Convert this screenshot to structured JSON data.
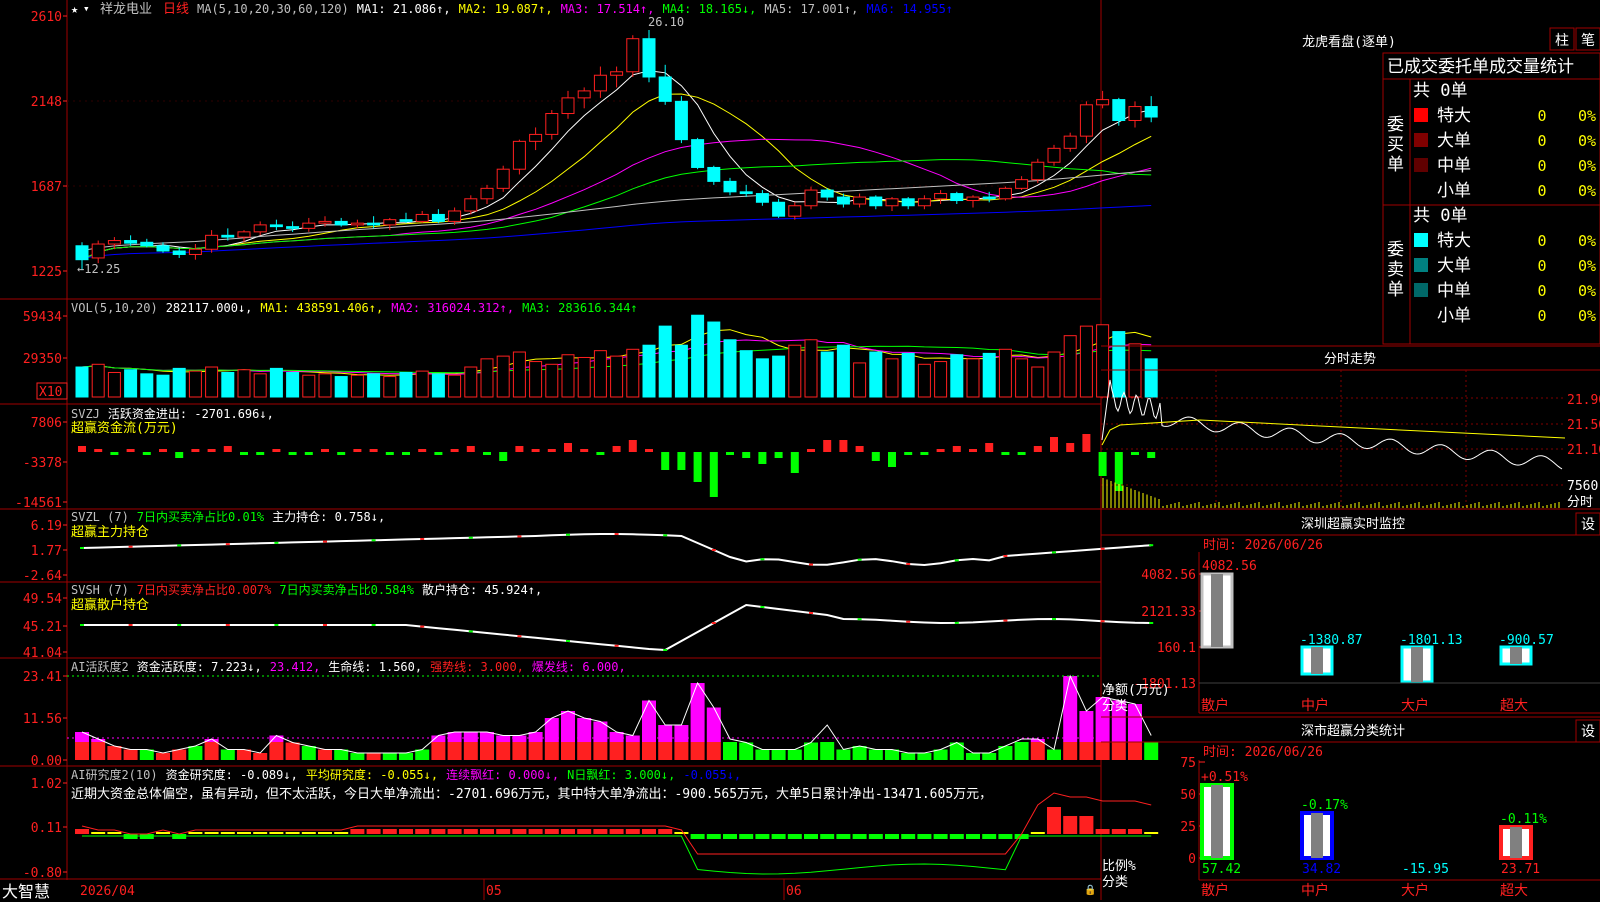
{
  "stock": {
    "name": "祥龙电业",
    "period": "日线"
  },
  "brand": "大智慧",
  "colors": {
    "up": "#ff2020",
    "down": "#00ffff",
    "green": "#00ff00",
    "yellow": "#ffff00",
    "magenta": "#ff00ff",
    "white": "#ffffff",
    "grid": "#a00000",
    "blue": "#0000ff",
    "orange": "#ff9900"
  },
  "kline_panel": {
    "header": [
      {
        "t": "MA(5,10,20,30,60,120)",
        "c": "#c0c0c0"
      },
      {
        "t": "MA1: 21.086↑,",
        "c": "#ffffff"
      },
      {
        "t": "MA2: 19.087↑,",
        "c": "#ffff00"
      },
      {
        "t": "MA3: 17.514↑,",
        "c": "#ff00ff"
      },
      {
        "t": "MA4: 18.165↓,",
        "c": "#00ff00"
      },
      {
        "t": "MA5: 17.001↑,",
        "c": "#c0c0c0"
      },
      {
        "t": "MA6: 14.955↑",
        "c": "#0000ff"
      }
    ],
    "y_labels": [
      "2610",
      "2148",
      "1687",
      "1225"
    ],
    "high_label": "26.10",
    "low_label": "←12.25"
  },
  "vol_panel": {
    "header": [
      {
        "t": "VOL(5,10,20)",
        "c": "#c0c0c0"
      },
      {
        "t": "282117.000↓,",
        "c": "#ffffff"
      },
      {
        "t": "MA1: 438591.406↑,",
        "c": "#ffff00"
      },
      {
        "t": "MA2: 316024.312↑,",
        "c": "#ff00ff"
      },
      {
        "t": "MA3: 283616.344↑",
        "c": "#00ff00"
      }
    ],
    "y_labels": [
      "59434",
      "29350"
    ],
    "unit": "X10"
  },
  "svzj_panel": {
    "header": [
      {
        "t": "SVZJ",
        "c": "#c0c0c0"
      },
      {
        "t": "活跃资金进出: -2701.696↓,",
        "c": "#ffffff"
      }
    ],
    "subtitle": "超赢资金流(万元)",
    "y_labels": [
      "7806",
      "-3378",
      "-14561"
    ]
  },
  "svzl_panel": {
    "header": [
      {
        "t": "SVZL (7)",
        "c": "#c0c0c0"
      },
      {
        "t": "7日内买卖净占比0.01%",
        "c": "#00ff00"
      },
      {
        "t": "主力持仓: 0.758↓,",
        "c": "#ffffff"
      }
    ],
    "subtitle": "超赢主力持仓",
    "y_labels": [
      "6.19",
      "1.77",
      "-2.64"
    ]
  },
  "svsh_panel": {
    "header": [
      {
        "t": "SVSH (7)",
        "c": "#c0c0c0"
      },
      {
        "t": "7日内买卖净占比0.007%",
        "c": "#ff2020"
      },
      {
        "t": "7日内买卖净占比0.584%",
        "c": "#00ff00"
      },
      {
        "t": "散户持仓: 45.924↑,",
        "c": "#ffffff"
      }
    ],
    "subtitle": "超赢散户持仓",
    "y_labels": [
      "49.54",
      "45.21",
      "41.04"
    ]
  },
  "ai1_panel": {
    "header": [
      {
        "t": "AI活跃度2",
        "c": "#c0c0c0"
      },
      {
        "t": "资金活跃度: 7.223↓,",
        "c": "#ffffff"
      },
      {
        "t": "23.412,",
        "c": "#ff00ff"
      },
      {
        "t": "生命线: 1.560,",
        "c": "#ffffff"
      },
      {
        "t": "强势线: 3.000,",
        "c": "#ff2020"
      },
      {
        "t": "爆发线: 6.000,",
        "c": "#ff00ff"
      }
    ],
    "y_labels": [
      "23.41",
      "11.56",
      "0.00"
    ]
  },
  "ai2_panel": {
    "header": [
      {
        "t": "AI研究度2(10)",
        "c": "#c0c0c0"
      },
      {
        "t": "资金研究度: -0.089↓,",
        "c": "#ffffff"
      },
      {
        "t": "平均研究度: -0.055↓,",
        "c": "#ffff00"
      },
      {
        "t": "连续飘红: 0.000↓,",
        "c": "#ff00ff"
      },
      {
        "t": "N日飘红: 3.000↓,",
        "c": "#00ff00"
      },
      {
        "t": "-0.055↓,",
        "c": "#0000ff"
      }
    ],
    "comment": "近期大资金总体偏空，虽有异动，但不太活跃，今日大单净流出：-2701.696万元，其中特大单净流出：-900.565万元，大单5日累计净出-13471.605万元，",
    "y_labels": [
      "1.02",
      "0.11",
      "-0.80"
    ]
  },
  "x_axis": [
    "2026/04",
    "05",
    "06"
  ],
  "longhu": {
    "title": "龙虎看盘(逐单)",
    "buttons": [
      "柱",
      "笔"
    ],
    "subtitle": "已成交委托单成交量统计",
    "buy": {
      "label": "委买单",
      "total": "共 0单",
      "rows": [
        [
          "特大",
          "0",
          "0%"
        ],
        [
          "大单",
          "0",
          "0%"
        ],
        [
          "中单",
          "0",
          "0%"
        ],
        [
          "小单",
          "0",
          "0%"
        ]
      ]
    },
    "sell": {
      "label": "委卖单",
      "total": "共 0单",
      "rows": [
        [
          "特大",
          "0",
          "0%"
        ],
        [
          "大单",
          "0",
          "0%"
        ],
        [
          "中单",
          "0",
          "0%"
        ],
        [
          "小单",
          "0",
          "0%"
        ]
      ]
    }
  },
  "intraday": {
    "title": "分时走势",
    "y_labels": [
      "21.90",
      "21.50",
      "21.10"
    ],
    "vol_label": "7560",
    "time_label": "分时"
  },
  "sz_monitor": {
    "title": "深圳超赢实时监控",
    "set": "设",
    "time": "时间: 2026/06/26",
    "y_labels": [
      "4082.56",
      "2121.33",
      "160.1",
      "-1801.13"
    ],
    "side_label": "净额(万元)",
    "cat_label": "分类",
    "bars": [
      {
        "cat": "散户",
        "v": "4082.56"
      },
      {
        "cat": "中户",
        "v": "-1380.87"
      },
      {
        "cat": "大户",
        "v": "-1801.13"
      },
      {
        "cat": "超大",
        "v": "-900.57"
      }
    ]
  },
  "sz_classify": {
    "title": "深市超赢分类统计",
    "set": "设",
    "time": "时间: 2026/06/26",
    "y_labels": [
      "75",
      "50",
      "25",
      "0"
    ],
    "side_label": "比例%",
    "cat_label": "分类",
    "bars": [
      {
        "cat": "散户",
        "top": "+0.51%",
        "bottom": "57.42"
      },
      {
        "cat": "中户",
        "top": "-0.17%",
        "bottom": "34.82"
      },
      {
        "cat": "大户",
        "top": "",
        "bottom": "-15.95"
      },
      {
        "cat": "超大",
        "top": "-0.11%",
        "bottom": "23.71"
      }
    ]
  },
  "chart_data": [
    {
      "type": "candlestick",
      "title": "祥龙电业 日线",
      "ylabel": "",
      "ylim": [
        12.25,
        26.1
      ],
      "series": [
        {
          "name": "K线",
          "ohlc": [
            [
              13.7,
              13.9,
              12.3,
              12.9
            ],
            [
              13.0,
              14.0,
              12.7,
              13.8
            ],
            [
              13.8,
              14.2,
              13.5,
              14.0
            ],
            [
              14.0,
              14.3,
              13.7,
              13.85
            ],
            [
              13.9,
              14.1,
              13.6,
              13.7
            ],
            [
              13.7,
              13.9,
              13.3,
              13.4
            ],
            [
              13.4,
              13.6,
              13.0,
              13.2
            ],
            [
              13.2,
              13.8,
              12.9,
              13.5
            ],
            [
              13.5,
              14.6,
              13.3,
              14.3
            ],
            [
              14.3,
              14.7,
              14.0,
              14.2
            ],
            [
              14.2,
              14.6,
              13.9,
              14.5
            ],
            [
              14.5,
              15.1,
              14.3,
              14.9
            ],
            [
              14.9,
              15.2,
              14.6,
              14.8
            ],
            [
              14.8,
              15.1,
              14.5,
              14.7
            ],
            [
              14.7,
              15.3,
              14.5,
              15.0
            ],
            [
              15.0,
              15.4,
              14.8,
              15.1
            ],
            [
              15.1,
              15.3,
              14.8,
              14.9
            ],
            [
              14.9,
              15.2,
              14.7,
              15.0
            ],
            [
              15.0,
              15.4,
              14.7,
              14.9
            ],
            [
              14.9,
              15.3,
              14.6,
              15.2
            ],
            [
              15.2,
              15.6,
              15.0,
              15.1
            ],
            [
              15.1,
              15.7,
              15.0,
              15.5
            ],
            [
              15.5,
              15.8,
              15.0,
              15.1
            ],
            [
              15.1,
              15.9,
              14.9,
              15.7
            ],
            [
              15.7,
              16.6,
              15.5,
              16.4
            ],
            [
              16.4,
              17.2,
              16.1,
              17.0
            ],
            [
              17.0,
              18.3,
              16.8,
              18.1
            ],
            [
              18.1,
              19.8,
              17.8,
              19.7
            ],
            [
              19.7,
              20.5,
              19.2,
              20.1
            ],
            [
              20.1,
              21.5,
              19.8,
              21.3
            ],
            [
              21.3,
              22.6,
              21.0,
              22.2
            ],
            [
              22.2,
              22.8,
              21.6,
              22.6
            ],
            [
              22.6,
              24.0,
              22.2,
              23.5
            ],
            [
              23.5,
              24.0,
              22.8,
              23.7
            ],
            [
              23.7,
              25.8,
              23.4,
              25.6
            ],
            [
              25.6,
              26.1,
              23.1,
              23.4
            ],
            [
              23.4,
              24.1,
              21.8,
              22.0
            ],
            [
              22.0,
              22.3,
              19.6,
              19.8
            ],
            [
              19.8,
              19.9,
              18.1,
              18.2
            ],
            [
              18.2,
              18.3,
              17.2,
              17.4
            ],
            [
              17.4,
              17.6,
              16.6,
              16.8
            ],
            [
              16.8,
              17.2,
              16.5,
              16.7
            ],
            [
              16.7,
              16.9,
              16.0,
              16.2
            ],
            [
              16.2,
              16.4,
              15.3,
              15.4
            ],
            [
              15.4,
              16.2,
              15.2,
              16.0
            ],
            [
              16.0,
              17.1,
              15.8,
              16.9
            ],
            [
              16.9,
              17.0,
              16.3,
              16.5
            ],
            [
              16.5,
              16.7,
              15.9,
              16.1
            ],
            [
              16.1,
              16.7,
              15.9,
              16.5
            ],
            [
              16.5,
              16.6,
              15.8,
              16.0
            ],
            [
              16.0,
              16.5,
              15.7,
              16.4
            ],
            [
              16.4,
              16.5,
              15.8,
              16.0
            ],
            [
              16.0,
              16.6,
              15.8,
              16.4
            ],
            [
              16.4,
              16.9,
              16.1,
              16.7
            ],
            [
              16.7,
              16.8,
              16.1,
              16.3
            ],
            [
              16.3,
              16.6,
              15.9,
              16.5
            ],
            [
              16.5,
              16.8,
              16.2,
              16.4
            ],
            [
              16.4,
              17.1,
              16.3,
              17.0
            ],
            [
              17.0,
              17.7,
              16.9,
              17.5
            ],
            [
              17.5,
              18.7,
              17.3,
              18.5
            ],
            [
              18.5,
              19.5,
              18.3,
              19.3
            ],
            [
              19.3,
              20.2,
              19.1,
              20.0
            ],
            [
              20.0,
              22.0,
              19.6,
              21.8
            ],
            [
              21.8,
              22.6,
              21.6,
              22.1
            ],
            [
              22.1,
              22.2,
              20.6,
              20.9
            ],
            [
              20.9,
              22.0,
              20.5,
              21.7
            ],
            [
              21.7,
              22.3,
              20.8,
              21.1
            ]
          ]
        }
      ]
    },
    {
      "type": "bar",
      "title": "VOL(5,10,20)",
      "ylim": [
        0,
        59434
      ],
      "series": [
        {
          "name": "VOL",
          "values": [
            22000,
            24000,
            18000,
            20000,
            17000,
            16000,
            21000,
            19000,
            22000,
            18000,
            20000,
            17000,
            21000,
            18000,
            16000,
            17000,
            15000,
            16000,
            17000,
            15000,
            18000,
            19000,
            17000,
            16000,
            22000,
            28000,
            30000,
            33000,
            26000,
            24000,
            31000,
            29000,
            34000,
            30000,
            35000,
            38000,
            52000,
            38000,
            60000,
            55000,
            42000,
            34000,
            28000,
            30000,
            38000,
            42000,
            33000,
            38000,
            25000,
            33000,
            28000,
            32000,
            24000,
            26000,
            31000,
            28000,
            32000,
            35000,
            28000,
            22000,
            33000,
            45000,
            52000,
            53000,
            48000,
            39000,
            28000
          ]
        }
      ]
    }
  ]
}
